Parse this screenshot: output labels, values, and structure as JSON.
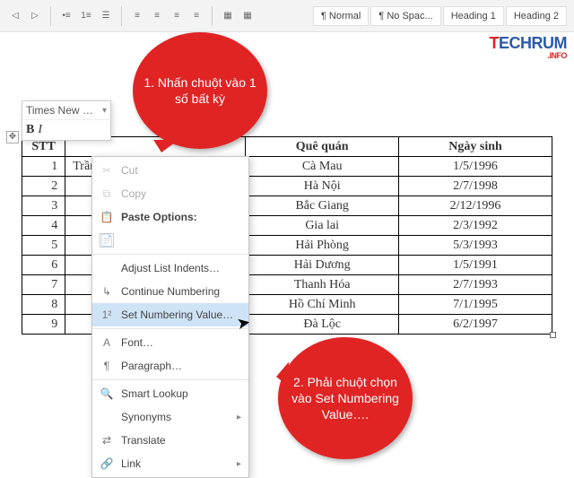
{
  "ribbon": {
    "styles": [
      "¶ Normal",
      "¶ No Spac...",
      "Heading 1",
      "Heading 2"
    ]
  },
  "logo": {
    "t": "T",
    "rest": "ECHRUM",
    "info": ".INFO"
  },
  "miniToolbar": {
    "font": "Times New …",
    "bold": "B",
    "italic": "I"
  },
  "table": {
    "headers": {
      "stt": "STT",
      "name": "",
      "que": "Quê quán",
      "date": "Ngày sinh"
    },
    "rows": [
      {
        "stt": "1",
        "name": "Trần Văn A...",
        "que": "Cà Mau",
        "date": "1/5/1996"
      },
      {
        "stt": "2",
        "name": "",
        "que": "Hà Nội",
        "date": "2/7/1998"
      },
      {
        "stt": "3",
        "name": "",
        "que": "Bắc Giang",
        "date": "2/12/1996"
      },
      {
        "stt": "4",
        "name": "",
        "que": "Gia lai",
        "date": "2/3/1992"
      },
      {
        "stt": "5",
        "name": "",
        "que": "Hải Phòng",
        "date": "5/3/1993"
      },
      {
        "stt": "6",
        "name": "",
        "que": "Hải Dương",
        "date": "1/5/1991"
      },
      {
        "stt": "7",
        "name": "",
        "que": "Thanh Hóa",
        "date": "2/7/1993"
      },
      {
        "stt": "8",
        "name": "",
        "que": "Hồ Chí Minh",
        "date": "7/1/1995"
      },
      {
        "stt": "9",
        "name": "",
        "que": "Đà Lộc",
        "date": "6/2/1997"
      }
    ]
  },
  "contextMenu": {
    "cut": "Cut",
    "copy": "Copy",
    "pasteOptions": "Paste Options:",
    "adjustIndents": "Adjust List Indents…",
    "continueNumbering": "Continue Numbering",
    "setNumberingValue": "Set Numbering Value…",
    "font": "Font…",
    "paragraph": "Paragraph…",
    "smartLookup": "Smart Lookup",
    "synonyms": "Synonyms",
    "translate": "Translate",
    "link": "Link"
  },
  "bubbles": {
    "b1": "1. Nhấn chuột vào 1 số bất kỳ",
    "b2": "2. Phải chuột chọn vào Set Numbering Value…."
  }
}
